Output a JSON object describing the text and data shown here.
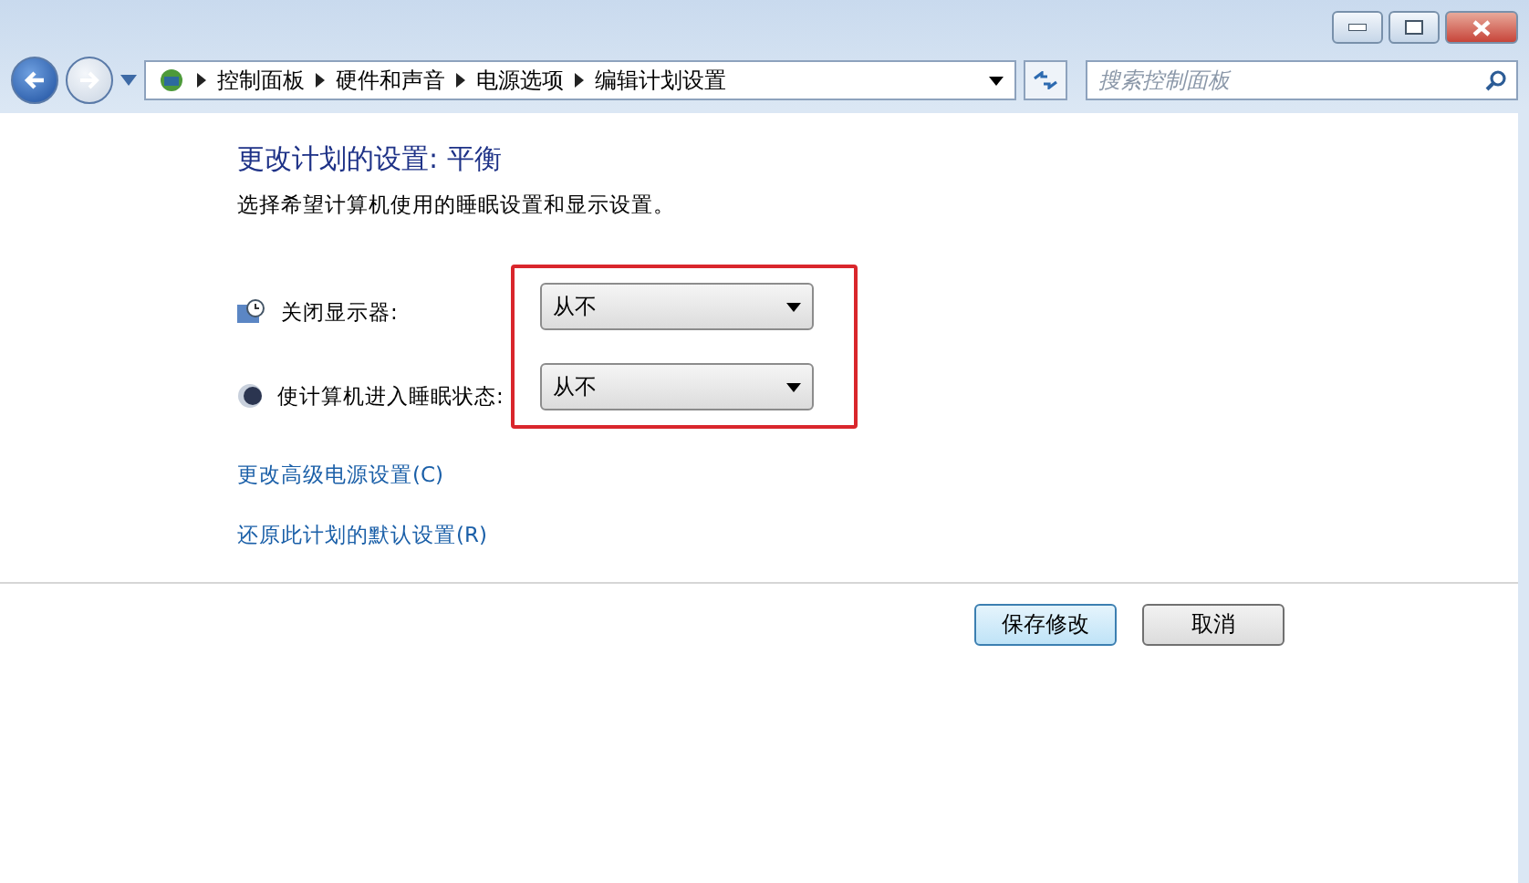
{
  "breadcrumb": [
    "控制面板",
    "硬件和声音",
    "电源选项",
    "编辑计划设置"
  ],
  "search": {
    "placeholder": "搜索控制面板"
  },
  "heading": "更改计划的设置: 平衡",
  "description": "选择希望计算机使用的睡眠设置和显示设置。",
  "settings": [
    {
      "kind": "display",
      "label": "关闭显示器:",
      "value": "从不"
    },
    {
      "kind": "sleep",
      "label": "使计算机进入睡眠状态:",
      "value": "从不"
    }
  ],
  "links": [
    "更改高级电源设置(C)",
    "还原此计划的默认设置(R)"
  ],
  "buttons": [
    {
      "label": "保存修改",
      "default": true
    },
    {
      "label": "取消",
      "default": false
    }
  ]
}
